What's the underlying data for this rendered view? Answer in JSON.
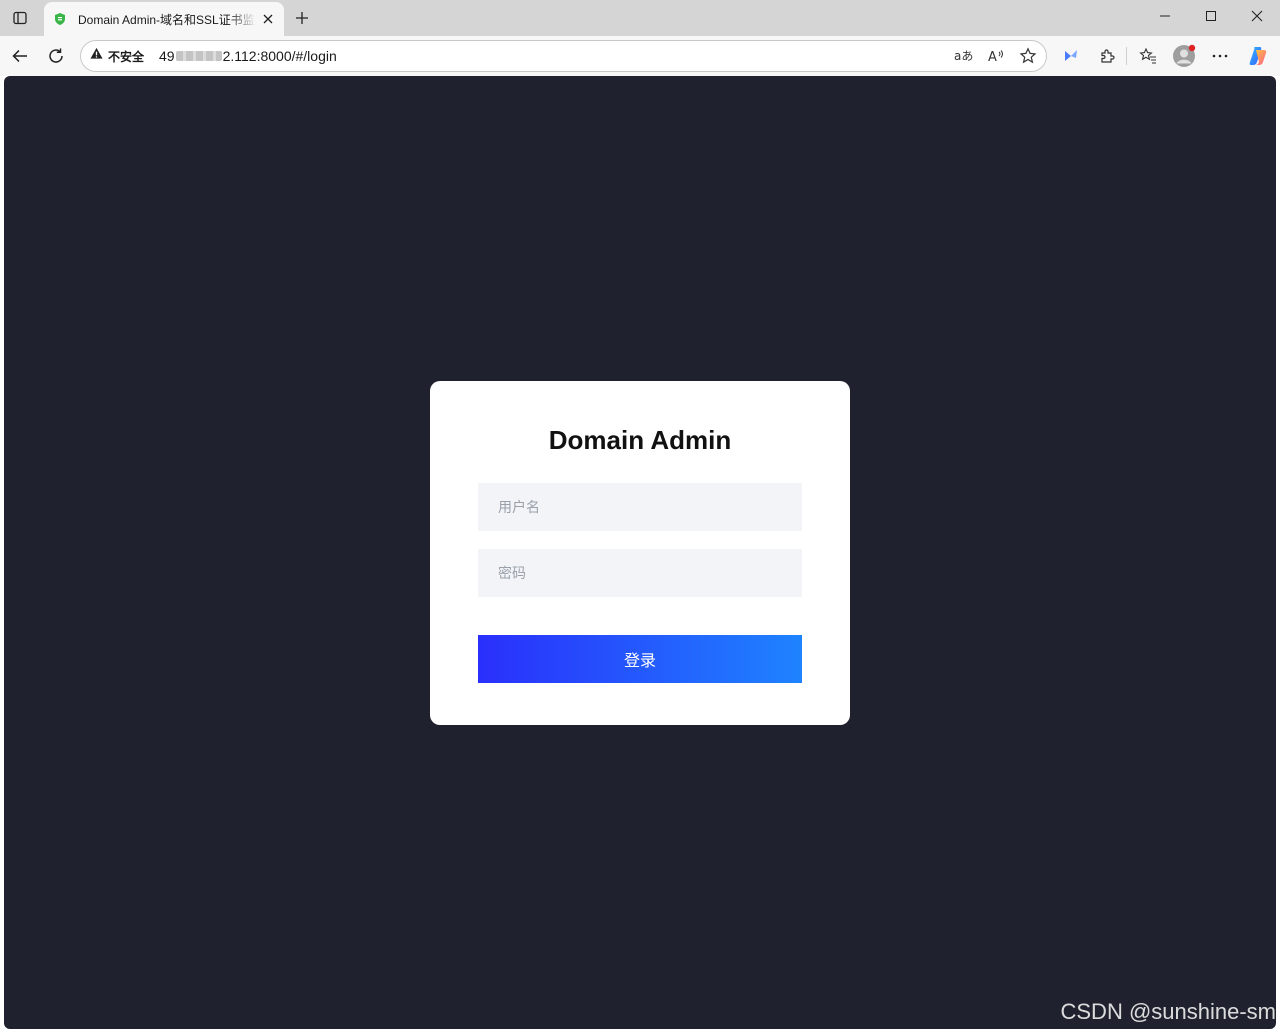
{
  "browser": {
    "tab": {
      "title": "Domain Admin-域名和SSL证书监控",
      "favicon": "shield-icon"
    },
    "address_bar": {
      "security_label": "不安全",
      "url_prefix": "49",
      "url_suffix": "2.112:8000/#/login"
    },
    "toolbar_icons": [
      "back-icon",
      "refresh-icon",
      "read-aloud-icon",
      "favorite-icon",
      "extensions-icon",
      "favorites-icon",
      "profile-icon",
      "more-icon",
      "copilot-icon"
    ]
  },
  "login": {
    "title": "Domain Admin",
    "username_placeholder": "用户名",
    "password_placeholder": "密码",
    "submit_label": "登录"
  },
  "watermark": "CSDN @sunshine-sm",
  "colors": {
    "page_background": "#1f222e",
    "card_background": "#ffffff",
    "input_background": "#f2f4f8",
    "button_gradient_start": "#2a2ffb",
    "button_gradient_end": "#1e83ff"
  }
}
